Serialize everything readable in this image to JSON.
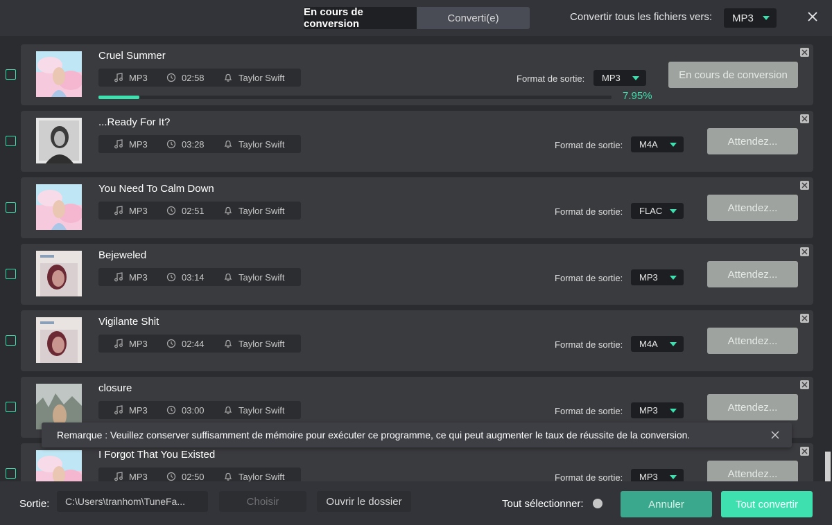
{
  "header": {
    "tabs": [
      {
        "label": "En cours de conversion",
        "active": true
      },
      {
        "label": "Converti(e)",
        "active": false
      }
    ],
    "convert_all_label": "Convertir tous les fichiers vers:",
    "convert_all_value": "MP3"
  },
  "songs": [
    {
      "title": "Cruel Summer",
      "format": "MP3",
      "duration": "02:58",
      "artist": "Taylor Swift",
      "output_format": "MP3",
      "state": "En cours de conversion",
      "progress_text": "7.95%",
      "progress": 0.0795,
      "cover": "pastel"
    },
    {
      "title": "...Ready For It?",
      "format": "MP3",
      "duration": "03:28",
      "artist": "Taylor Swift",
      "output_format": "M4A",
      "state": "Attendez...",
      "cover": "mono"
    },
    {
      "title": "You Need To Calm Down",
      "format": "MP3",
      "duration": "02:51",
      "artist": "Taylor Swift",
      "output_format": "FLAC",
      "state": "Attendez...",
      "cover": "pastel"
    },
    {
      "title": "Bejeweled",
      "format": "MP3",
      "duration": "03:14",
      "artist": "Taylor Swift",
      "output_format": "MP3",
      "state": "Attendez...",
      "cover": "midnights"
    },
    {
      "title": "Vigilante Shit",
      "format": "MP3",
      "duration": "02:44",
      "artist": "Taylor Swift",
      "output_format": "M4A",
      "state": "Attendez...",
      "cover": "midnights"
    },
    {
      "title": "closure",
      "format": "MP3",
      "duration": "03:00",
      "artist": "Taylor Swift",
      "output_format": "MP3",
      "state": "Attendez...",
      "cover": "forest"
    },
    {
      "title": "I Forgot That You Existed",
      "format": "MP3",
      "duration": "02:50",
      "artist": "Taylor Swift",
      "output_format": "MP3",
      "state": "Attendez...",
      "cover": "pastel"
    }
  ],
  "row_labels": {
    "format_label": "Format de sortie:"
  },
  "toast": {
    "message": "Remarque : Veuillez conserver suffisamment de mémoire pour exécuter ce programme, ce qui peut augmenter le taux de réussite de la conversion."
  },
  "footer": {
    "output_label": "Sortie:",
    "output_path": "C:\\Users\\tranhom\\TuneFa...",
    "choose_label": "Choisir",
    "open_folder_label": "Ouvrir le dossier",
    "select_all_label": "Tout sélectionner:",
    "cancel_label": "Annuler",
    "convert_all_button": "Tout convertir"
  },
  "colors": {
    "accent": "#3fe0b0",
    "background": "#2b2c2f",
    "row": "#3a3b3e",
    "wait_button": "#9ea39f"
  }
}
